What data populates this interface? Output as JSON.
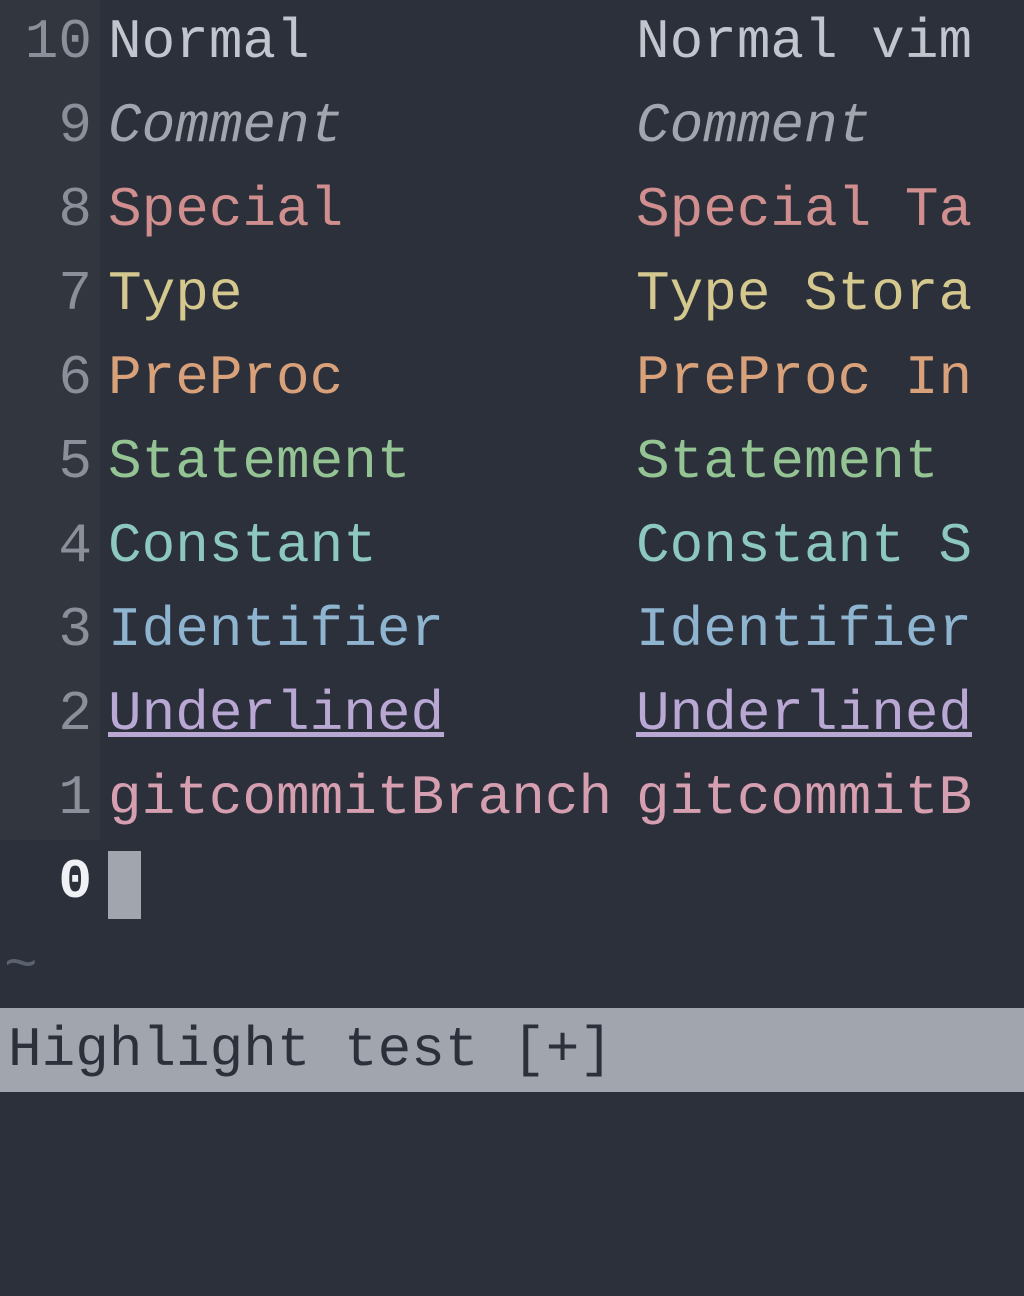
{
  "rows": [
    {
      "num": "10",
      "cls": "c-normal",
      "col1": "Normal",
      "col2": "Normal vim"
    },
    {
      "num": "9",
      "cls": "c-comment",
      "col1": "Comment",
      "col2": "Comment"
    },
    {
      "num": "8",
      "cls": "c-special",
      "col1": "Special",
      "col2": "Special Ta"
    },
    {
      "num": "7",
      "cls": "c-type",
      "col1": "Type",
      "col2": "Type Stora"
    },
    {
      "num": "6",
      "cls": "c-preproc",
      "col1": "PreProc",
      "col2": "PreProc In"
    },
    {
      "num": "5",
      "cls": "c-statement",
      "col1": "Statement",
      "col2": "Statement"
    },
    {
      "num": "4",
      "cls": "c-constant",
      "col1": "Constant",
      "col2": "Constant S"
    },
    {
      "num": "3",
      "cls": "c-identifier",
      "col1": "Identifier",
      "col2": "Identifier"
    },
    {
      "num": "2",
      "cls": "c-underlined",
      "col1": "Underlined",
      "col2": "Underlined"
    },
    {
      "num": "1",
      "cls": "c-gitcommit",
      "col1": "gitcommitBranch",
      "col2": "gitcommitB"
    }
  ],
  "cursor_line_num": "0",
  "tilde": "~",
  "statusline": "Highlight test [+]"
}
